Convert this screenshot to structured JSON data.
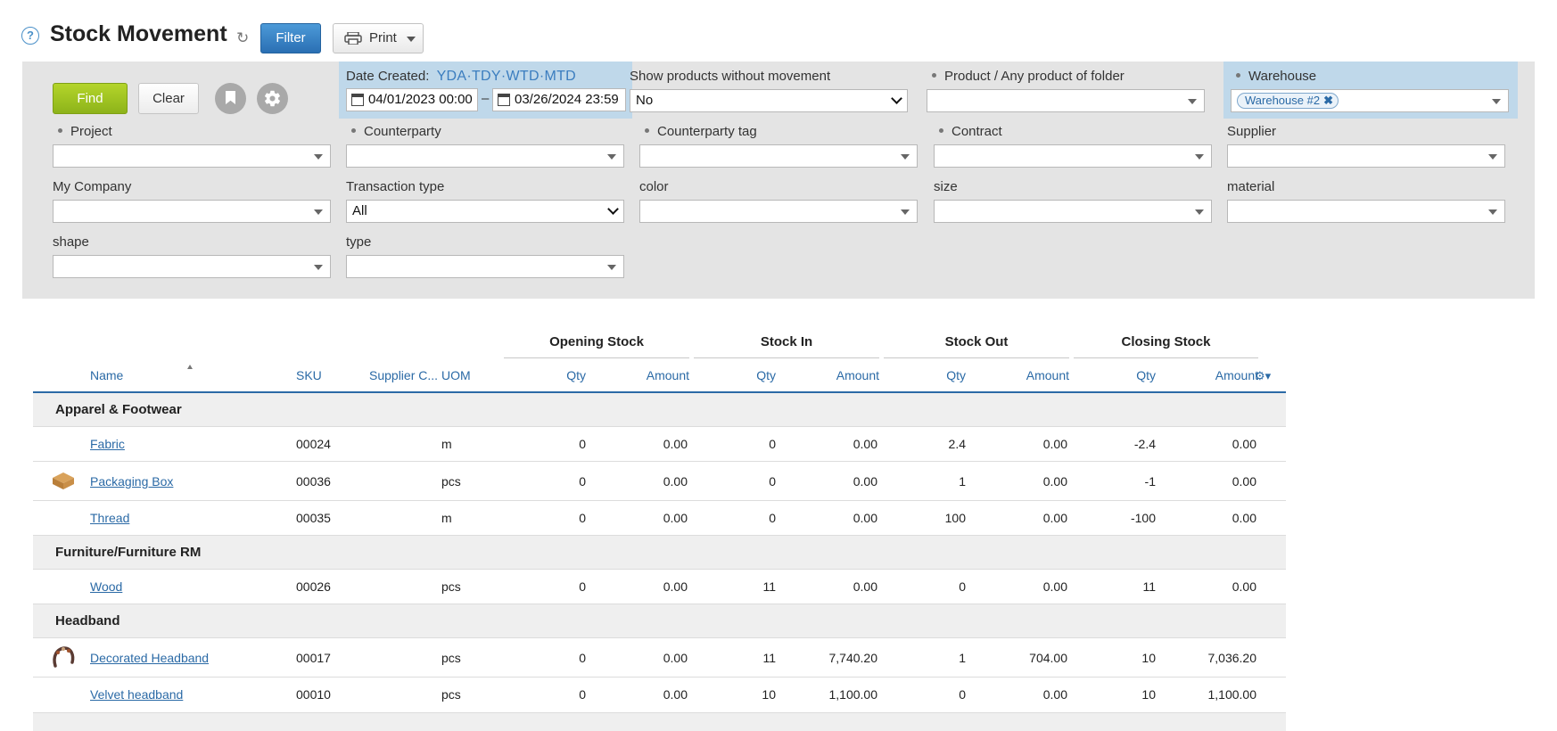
{
  "header": {
    "title": "Stock Movement",
    "filter_label": "Filter",
    "print_label": "Print"
  },
  "filters": {
    "find_label": "Find",
    "clear_label": "Clear",
    "date_created": {
      "label": "Date Created:",
      "quick": "YDA·TDY·WTD·MTD",
      "from": "04/01/2023 00:00",
      "separator": "–",
      "to": "03/26/2024 23:59"
    },
    "show_without_movement": {
      "label": "Show products without movement",
      "value": "No"
    },
    "product": {
      "label": "Product / Any product of folder",
      "value": ""
    },
    "warehouse": {
      "label": "Warehouse",
      "tag": "Warehouse #2"
    },
    "project": {
      "label": "Project",
      "value": ""
    },
    "counterparty": {
      "label": "Counterparty",
      "value": ""
    },
    "counterparty_tag": {
      "label": "Counterparty tag",
      "value": ""
    },
    "contract": {
      "label": "Contract",
      "value": ""
    },
    "supplier": {
      "label": "Supplier",
      "value": ""
    },
    "my_company": {
      "label": "My Company",
      "value": ""
    },
    "transaction_type": {
      "label": "Transaction type",
      "value": "All"
    },
    "color": {
      "label": "color",
      "value": ""
    },
    "size": {
      "label": "size",
      "value": ""
    },
    "material": {
      "label": "material",
      "value": ""
    },
    "shape": {
      "label": "shape",
      "value": ""
    },
    "type": {
      "label": "type",
      "value": ""
    }
  },
  "table": {
    "groups": [
      "Opening Stock",
      "Stock In",
      "Stock Out",
      "Closing Stock"
    ],
    "columns": {
      "name": "Name",
      "sku": "SKU",
      "supplier_code": "Supplier C...",
      "uom": "UOM",
      "qty": "Qty",
      "amount": "Amount"
    },
    "categories": [
      {
        "name": "Apparel & Footwear",
        "rows": [
          {
            "name": "Fabric",
            "sku": "00024",
            "uom": "m",
            "open_qty": "0",
            "open_amt": "0.00",
            "in_qty": "0",
            "in_amt": "0.00",
            "out_qty": "2.4",
            "out_amt": "0.00",
            "close_qty": "-2.4",
            "close_amt": "0.00",
            "thumb": ""
          },
          {
            "name": "Packaging Box",
            "sku": "00036",
            "uom": "pcs",
            "open_qty": "0",
            "open_amt": "0.00",
            "in_qty": "0",
            "in_amt": "0.00",
            "out_qty": "1",
            "out_amt": "0.00",
            "close_qty": "-1",
            "close_amt": "0.00",
            "thumb": "box-thumbnail"
          },
          {
            "name": "Thread",
            "sku": "00035",
            "uom": "m",
            "open_qty": "0",
            "open_amt": "0.00",
            "in_qty": "0",
            "in_amt": "0.00",
            "out_qty": "100",
            "out_amt": "0.00",
            "close_qty": "-100",
            "close_amt": "0.00",
            "thumb": ""
          }
        ]
      },
      {
        "name": "Furniture/Furniture RM",
        "rows": [
          {
            "name": "Wood",
            "sku": "00026",
            "uom": "pcs",
            "open_qty": "0",
            "open_amt": "0.00",
            "in_qty": "11",
            "in_amt": "0.00",
            "out_qty": "0",
            "out_amt": "0.00",
            "close_qty": "11",
            "close_amt": "0.00",
            "thumb": ""
          }
        ]
      },
      {
        "name": "Headband",
        "rows": [
          {
            "name": "Decorated Headband",
            "sku": "00017",
            "uom": "pcs",
            "open_qty": "0",
            "open_amt": "0.00",
            "in_qty": "11",
            "in_amt": "7,740.20",
            "out_qty": "1",
            "out_amt": "704.00",
            "close_qty": "10",
            "close_amt": "7,036.20",
            "thumb": "headband-thumbnail"
          },
          {
            "name": "Velvet headband",
            "sku": "00010",
            "uom": "pcs",
            "open_qty": "0",
            "open_amt": "0.00",
            "in_qty": "10",
            "in_amt": "1,100.00",
            "out_qty": "0",
            "out_amt": "0.00",
            "close_qty": "10",
            "close_amt": "1,100.00",
            "thumb": ""
          }
        ]
      }
    ]
  },
  "colors": {
    "accent_blue": "#2b6aa6",
    "find_green": "#9dc21f",
    "panel_gray": "#e4e4e4",
    "highlight_blue": "#bfd8ea"
  }
}
